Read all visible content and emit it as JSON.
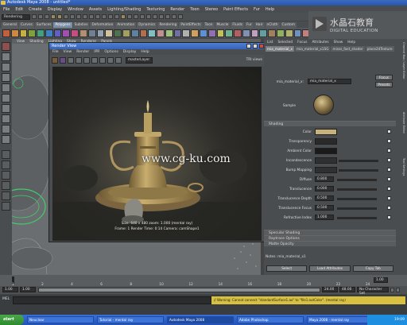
{
  "window": {
    "title": "Autodesk Maya 2008 - untitled*"
  },
  "menubar": [
    "File",
    "Edit",
    "Create",
    "Display",
    "Window",
    "Assets",
    "Lighting/Shading",
    "Texturing",
    "Render",
    "Toon",
    "Stereo",
    "Paint Effects",
    "Fur",
    "Help"
  ],
  "status_line": {
    "mode": "Rendering"
  },
  "shelf": {
    "tabs": [
      "General",
      "Curves",
      "Surfaces",
      "Polygons",
      "Subdivs",
      "Deformation",
      "Animation",
      "Dynamics",
      "Rendering",
      "PaintEffects",
      "Toon",
      "Muscle",
      "Fluids",
      "Fur",
      "Hair",
      "nCloth",
      "Custom"
    ],
    "active_tab": "Polygons"
  },
  "watermark": {
    "title": "水晶石教育",
    "subtitle": "DIGITAL EDUCATION",
    "url": "www.cg-ku.com"
  },
  "viewport": {
    "menu": [
      "View",
      "Shading",
      "Lighting",
      "Show",
      "Renderer",
      "Panels"
    ]
  },
  "render_view": {
    "title": "Render View",
    "menu": [
      "File",
      "View",
      "Render",
      "IPR",
      "Options",
      "Display",
      "Help"
    ],
    "layer_dropdown": "masterLayer",
    "render_time_label": "TRI views",
    "info_line1": "Size: 640 x 480 zoom: 1.000     (mental ray)",
    "info_line2": "Frame: 1   Render Time: 0:14   Camera: camShape1"
  },
  "attribute_editor": {
    "title": "Attribute Editor",
    "menu": [
      "List",
      "Selected",
      "Focus",
      "Attributes",
      "Show",
      "Help"
    ],
    "tabs": [
      "mia_material_x",
      "mia_material_x1SG",
      "misss_fast_shader",
      "place2dTexture"
    ],
    "shader_type_label": "mia_material_x:",
    "shader_name": "mia_material_x",
    "focus_button": "Focus",
    "presets_button": "Presets",
    "sample_label": "Sample",
    "section_shading": "Shading",
    "attributes": [
      {
        "label": "Color",
        "value": ""
      },
      {
        "label": "Transparency",
        "value": ""
      },
      {
        "label": "Ambient Color",
        "value": ""
      },
      {
        "label": "Incandescence",
        "value": ""
      },
      {
        "label": "Bump Mapping",
        "value": ""
      },
      {
        "label": "Diffuse",
        "value": "0.800"
      },
      {
        "label": "Translucence",
        "value": "0.000"
      },
      {
        "label": "Translucence Depth",
        "value": "0.500"
      },
      {
        "label": "Translucence Focus",
        "value": "0.500"
      },
      {
        "label": "Refractive Index",
        "value": "1.000"
      }
    ],
    "sections_collapsed": [
      "Specular Shading",
      "Raytrace Options",
      "Matte Opacity"
    ],
    "notes_label": "Notes: mia_material_x1",
    "buttons": [
      "Select",
      "Load Attributes",
      "Copy Tab"
    ]
  },
  "right_tabs": [
    "Channel Box / Layer Editor",
    "Attribute Editor",
    "Tool Settings"
  ],
  "timeline": {
    "ticks": [
      "1",
      "2",
      "4",
      "6",
      "8",
      "10",
      "12",
      "14",
      "16",
      "18",
      "20",
      "22",
      "24"
    ],
    "current_frame": "1.00",
    "range_start": "1.00",
    "range_end": "24.00",
    "anim_end": "48.00",
    "char_set": "No Character Set"
  },
  "command_line": {
    "label": "MEL",
    "feedback": "// Warning: Cannot connect \"standardSurface1.ao\" to \"file1.outColor\". (mental ray)"
  },
  "taskbar": {
    "start": "start",
    "tasks": [
      "Neuclear",
      "Tutorial - mental ray",
      "Autodesk Maya 2008",
      "Adobe Photoshop",
      "Maya 2008 - mental ray"
    ],
    "active_task": 2,
    "clock": "19:09"
  },
  "colors": {
    "shelf_tab_active": "#7b8ea8",
    "title_bar": "#2a55a8",
    "color_swatch": "#c8b27c",
    "warning_bg": "#d8c040",
    "candle_brass": "#b89a5c"
  }
}
